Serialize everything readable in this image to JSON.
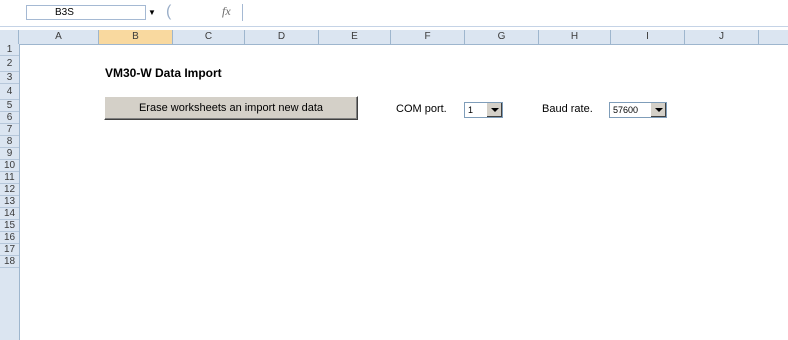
{
  "formula_bar": {
    "name_box": "B3S",
    "fx_label": "fx",
    "formula": ""
  },
  "columns": [
    "A",
    "B",
    "C",
    "D",
    "E",
    "F",
    "G",
    "H",
    "I",
    "J"
  ],
  "selected_column": "B",
  "rows": [
    "1",
    "2",
    "3",
    "4",
    "5",
    "6",
    "7",
    "8",
    "9",
    "10",
    "11",
    "12",
    "13",
    "14",
    "15",
    "16",
    "17",
    "18"
  ],
  "sheet": {
    "title": "VM30-W  Data Import",
    "erase_button": "Erase worksheets an import new data",
    "com_port_label": "COM port.",
    "com_port_value": "1",
    "baud_rate_label": "Baud rate.",
    "baud_rate_value": "57600"
  }
}
